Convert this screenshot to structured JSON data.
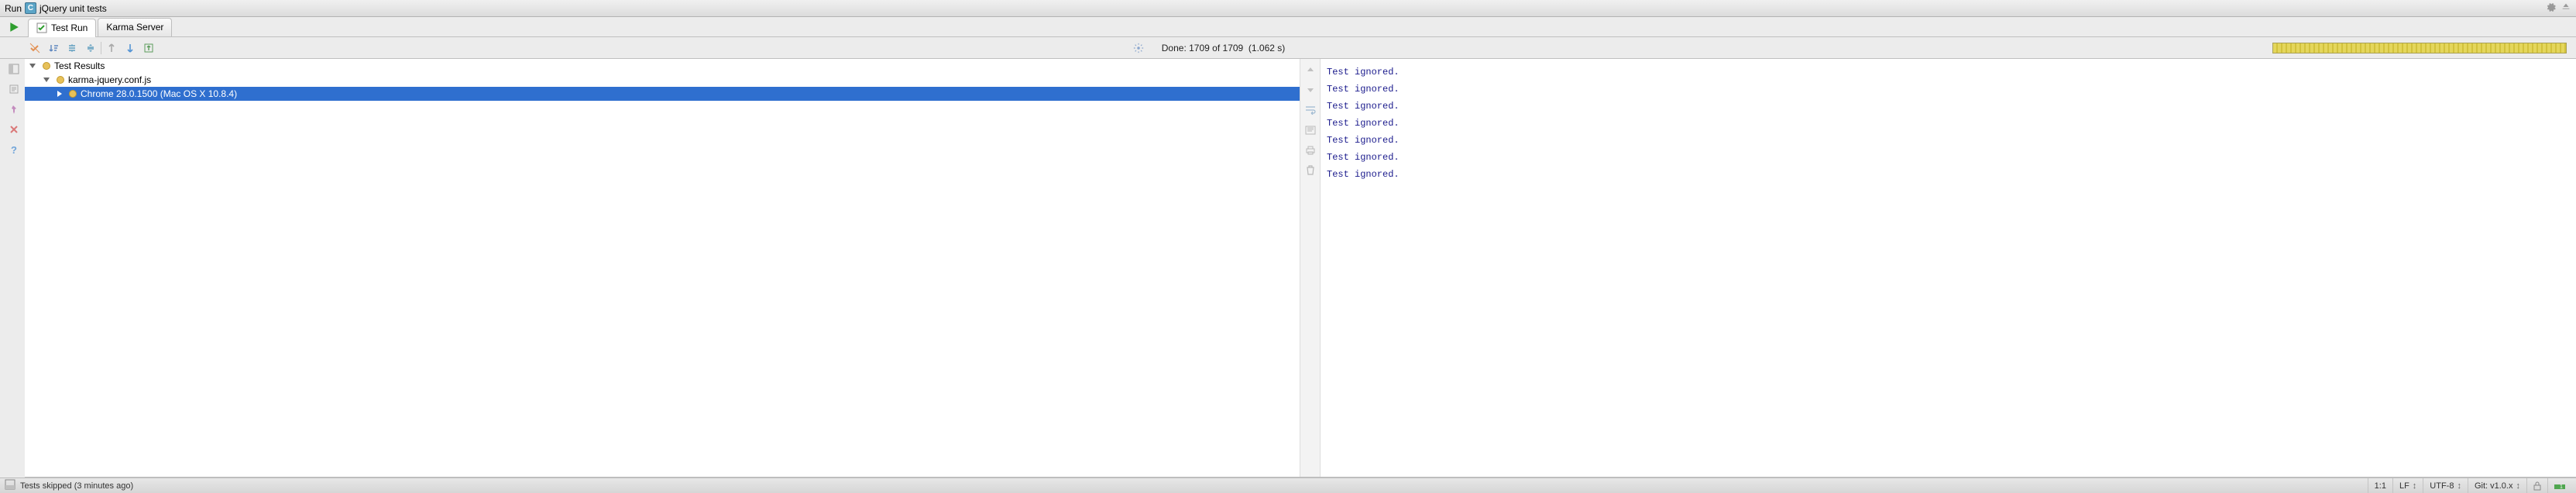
{
  "title": {
    "prefix": "Run",
    "name": "jQuery unit tests"
  },
  "tabs": [
    {
      "label": "Test Run",
      "active": true
    },
    {
      "label": "Karma Server",
      "active": false
    }
  ],
  "status": {
    "prefix": "Done:",
    "done": "1709",
    "of_word": "of",
    "total": "1709",
    "time": "(1.062 s)"
  },
  "progress_percent": 100,
  "tree": {
    "root": {
      "label": "Test Results"
    },
    "conf": {
      "label": "karma-jquery.conf.js"
    },
    "browser": {
      "label": "Chrome 28.0.1500 (Mac OS X 10.8.4)"
    }
  },
  "console_lines": [
    "Test ignored.",
    "Test ignored.",
    "Test ignored.",
    "Test ignored.",
    "Test ignored.",
    "Test ignored.",
    "Test ignored."
  ],
  "footer": {
    "message": "Tests skipped (3 minutes ago)",
    "position": "1:1",
    "line_sep": "LF",
    "encoding": "UTF-8",
    "git": "Git: v1.0.x"
  }
}
